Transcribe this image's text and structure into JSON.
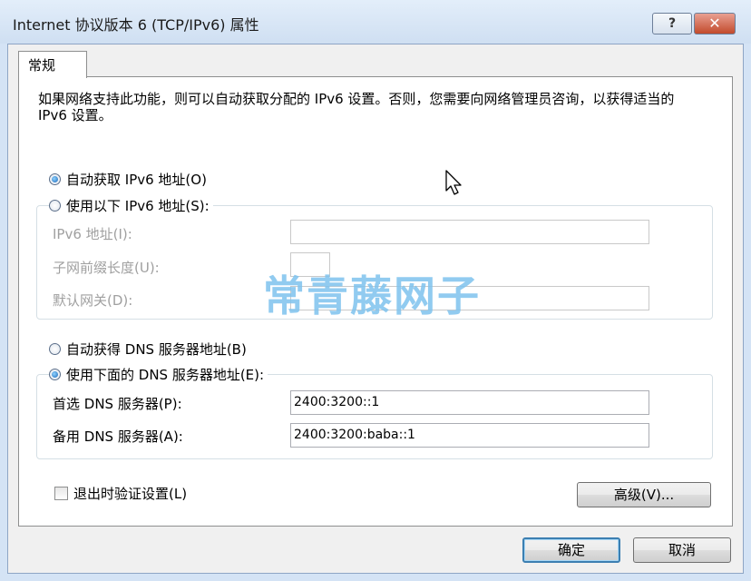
{
  "window": {
    "title": "Internet 协议版本 6 (TCP/IPv6) 属性",
    "help_label": "?",
    "close_label": "✕"
  },
  "tabs": [
    {
      "label": "常规"
    }
  ],
  "description": "如果网络支持此功能，则可以自动获取分配的 IPv6 设置。否则，您需要向网络管理员咨询，以获得适当的 IPv6 设置。",
  "ip_section": {
    "auto_label": "自动获取 IPv6 地址(O)",
    "auto_checked": true,
    "manual_label": "使用以下 IPv6 地址(S):",
    "manual_checked": false,
    "fields": {
      "ipv6_label": "IPv6 地址(I):",
      "ipv6_value": "",
      "prefix_label": "子网前缀长度(U):",
      "prefix_value": "",
      "gateway_label": "默认网关(D):",
      "gateway_value": ""
    }
  },
  "dns_section": {
    "auto_label": "自动获得 DNS 服务器地址(B)",
    "auto_checked": false,
    "manual_label": "使用下面的 DNS 服务器地址(E):",
    "manual_checked": true,
    "preferred_label": "首选 DNS 服务器(P):",
    "preferred_value": "2400:3200::1",
    "alternate_label": "备用 DNS 服务器(A):",
    "alternate_value": "2400:3200:baba::1"
  },
  "validate_label": "退出时验证设置(L)",
  "validate_checked": false,
  "advanced_label": "高级(V)...",
  "ok_label": "确定",
  "cancel_label": "取消",
  "watermark": "常青藤网子",
  "icons": {
    "cursor": "mouse-pointer-icon"
  }
}
